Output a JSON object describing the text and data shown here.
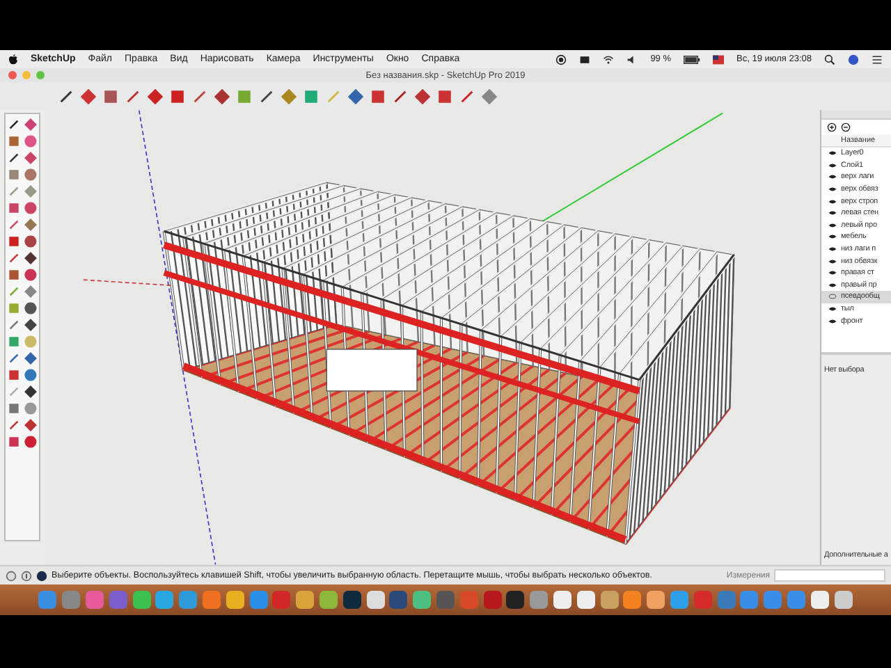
{
  "menu_bar": {
    "app_name": "SketchUp",
    "items": [
      "Файл",
      "Правка",
      "Вид",
      "Нарисовать",
      "Камера",
      "Инструменты",
      "Окно",
      "Справка"
    ],
    "battery": "99 %",
    "clock": "Вс, 19 июля  23:08"
  },
  "window": {
    "title": "Без названия.skp - SketchUp Pro 2019"
  },
  "layers_panel": {
    "column": "Название",
    "layers": [
      {
        "name": "Layer0",
        "visible": true,
        "selected": false
      },
      {
        "name": "Слой1",
        "visible": true,
        "selected": false
      },
      {
        "name": "верх лаги",
        "visible": true,
        "selected": false
      },
      {
        "name": "верх обвяз",
        "visible": true,
        "selected": false
      },
      {
        "name": "верх строп",
        "visible": true,
        "selected": false
      },
      {
        "name": "левая стен",
        "visible": true,
        "selected": false
      },
      {
        "name": "левый про",
        "visible": true,
        "selected": false
      },
      {
        "name": "мебель",
        "visible": true,
        "selected": false
      },
      {
        "name": "низ лаги п",
        "visible": true,
        "selected": false
      },
      {
        "name": "низ обвязк",
        "visible": true,
        "selected": false
      },
      {
        "name": "правая ст",
        "visible": true,
        "selected": false
      },
      {
        "name": "правый пр",
        "visible": true,
        "selected": false
      },
      {
        "name": "псевдообщ",
        "visible": false,
        "selected": true
      },
      {
        "name": "тыл",
        "visible": true,
        "selected": false
      },
      {
        "name": "фронт",
        "visible": true,
        "selected": false
      }
    ]
  },
  "entity_info": {
    "selection": "Нет выбора",
    "footer": "Дополнительные а"
  },
  "status_bar": {
    "message": "Выберите объекты. Воспользуйтесь клавишей Shift, чтобы увеличить выбранную область. Перетащите мышь, чтобы выбрать несколько объектов.",
    "measurements_label": "Измерения"
  }
}
